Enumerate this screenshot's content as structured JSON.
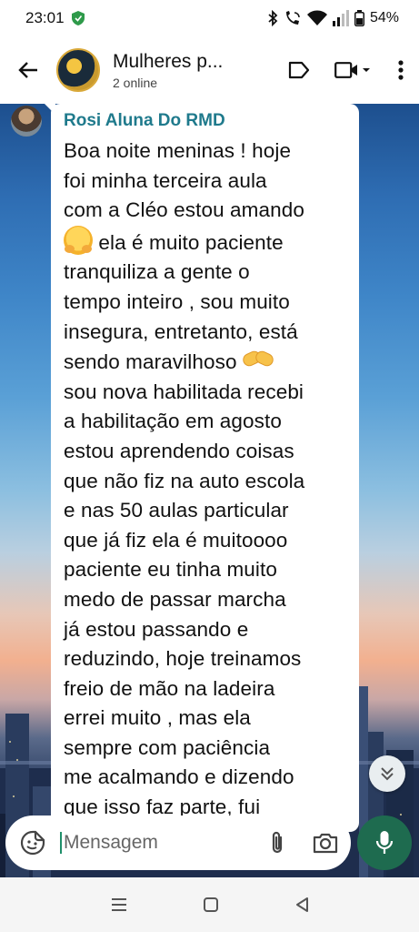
{
  "status_bar": {
    "time": "23:01",
    "battery": "54%"
  },
  "header": {
    "group_name": "Mulheres p...",
    "subtitle": "2 online"
  },
  "message": {
    "sender": "Rosi Aluna Do RMD",
    "line_1": "Boa noite meninas ! hoje\nfoi minha terceira aula\ncom a Cléo estou amando\n",
    "line_2": "  ela é muito paciente\ntranquiliza a gente o\ntempo inteiro , sou muito\ninsegura, entretanto, está\nsendo maravilhoso ",
    "line_3": "\nsou nova habilitada recebi\na habilitação   em agosto\nestou aprendendo coisas\nque não fiz na auto escola\ne nas 50 aulas particular\nque já fiz  ela é muitoooo\npaciente eu tinha muito\nmedo de passar marcha\njá estou passando e\nreduzindo, hoje treinamos\nfreio de mão na ladeira\nerrei muito , mas ela\nsempre com paciência\nme acalmando e dizendo\nque isso faz parte, fui\naté no mecânico levar"
  },
  "composer": {
    "placeholder": "Mensagem"
  },
  "icons": {
    "back": "arrow-left-icon",
    "label": "label-icon",
    "video": "video-call-icon",
    "more": "more-vert-icon",
    "sticker": "sticker-icon",
    "attach": "paperclip-icon",
    "camera": "camera-icon",
    "mic": "microphone-icon",
    "scroll": "double-chevron-down-icon"
  },
  "colors": {
    "sender_name": "#1f7a8c",
    "mic_button": "#1e6b4f"
  }
}
